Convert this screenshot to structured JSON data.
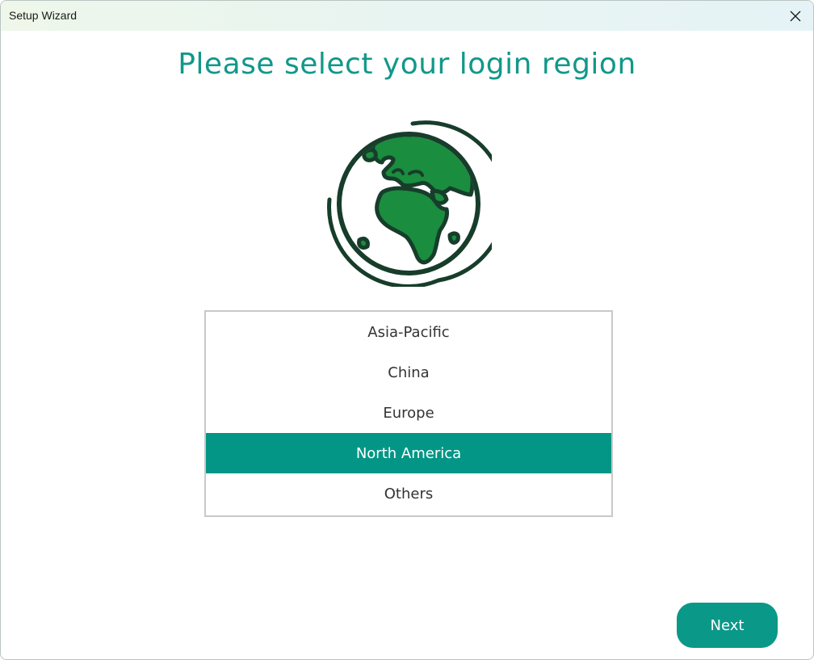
{
  "window": {
    "title": "Setup Wizard"
  },
  "heading": "Please select your login region",
  "illustration": {
    "icon": "globe-icon"
  },
  "regions": {
    "selected": "North America",
    "items": [
      {
        "label": "Asia-Pacific",
        "selected": false
      },
      {
        "label": "China",
        "selected": false
      },
      {
        "label": "Europe",
        "selected": false
      },
      {
        "label": "North America",
        "selected": true
      },
      {
        "label": "Others",
        "selected": false
      }
    ]
  },
  "buttons": {
    "next_label": "Next"
  },
  "colors": {
    "accent": "#039686",
    "heading": "#11988a",
    "globe_green": "#1a8d3e",
    "globe_outline": "#173d2b"
  }
}
